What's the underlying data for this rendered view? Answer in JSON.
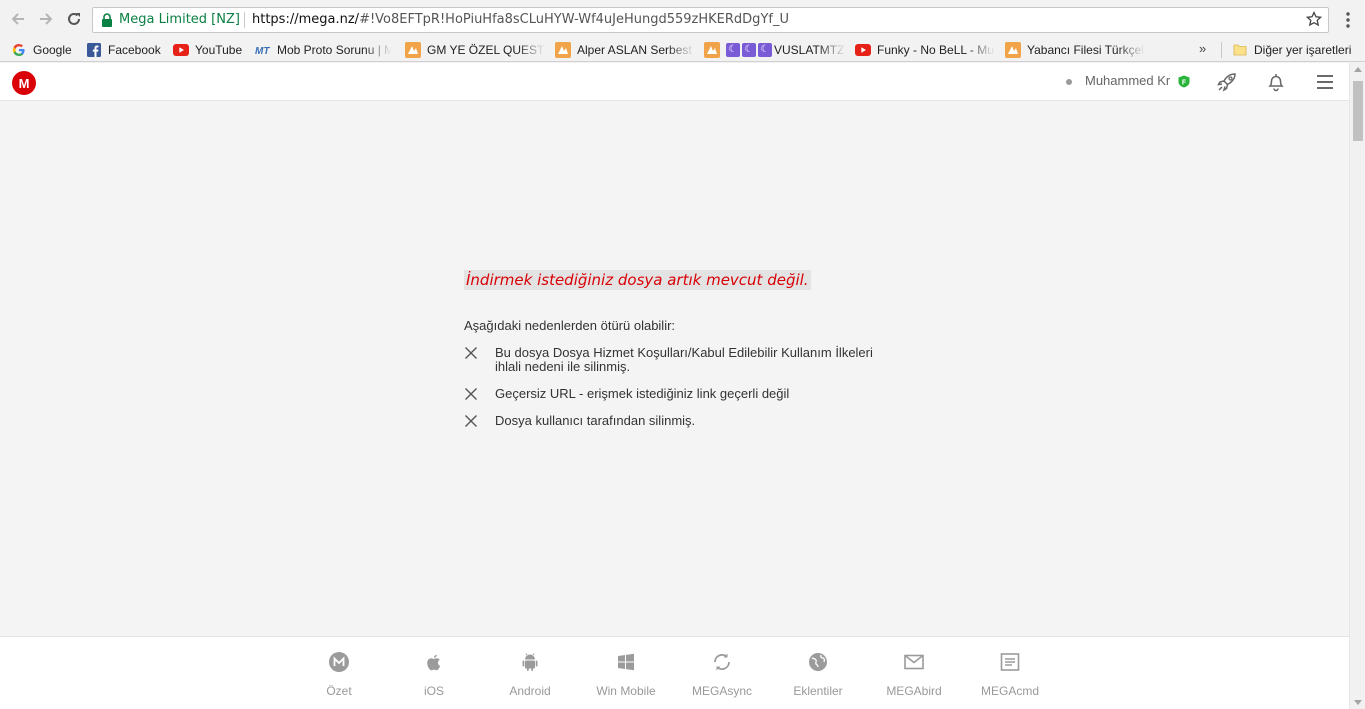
{
  "browser": {
    "secure_label": "Mega Limited [NZ]",
    "url_host": "https://mega.nz/",
    "url_path": "#!Vo8EFTpR!HoPiuHfa8sCLuHYW-Wf4uJeHungd559zHKERdDgYf_U",
    "bookmarks": [
      {
        "label": "Google",
        "icon": "google-icon"
      },
      {
        "label": "Facebook",
        "icon": "facebook-icon"
      },
      {
        "label": "YouTube",
        "icon": "youtube-icon"
      },
      {
        "label": "Mob Proto Sorunu | M",
        "icon": "mt-icon"
      },
      {
        "label": "GM YE ÖZEL QUEST |",
        "icon": "site-icon"
      },
      {
        "label": "Alper ASLAN Serbest",
        "icon": "site-icon"
      },
      {
        "label": "VUSLATMTZ",
        "icon": "site-icon"
      },
      {
        "label": "Funky - No BeLL - Mu",
        "icon": "youtube-icon"
      },
      {
        "label": "Yabancı Filesi Türkçele",
        "icon": "site-icon"
      }
    ],
    "more_bookmarks": "»",
    "other_bookmarks": "Diğer yer işaretleri"
  },
  "header": {
    "logo": "M",
    "username": "Muhammed Kr",
    "badge": "F"
  },
  "error": {
    "title": "İndirmek istediğiniz dosya artık mevcut değil.",
    "intro": "Aşağıdaki nedenlerden ötürü olabilir:",
    "reasons": [
      "Bu dosya Dosya Hizmet Koşulları/Kabul Edilebilir Kullanım İlkeleri ihlali nedeni ile silinmiş.",
      "Geçersiz URL - erişmek istediğiniz link geçerli değil",
      "Dosya kullanıcı tarafından silinmiş."
    ]
  },
  "footer": {
    "items": [
      {
        "label": "Özet",
        "icon": "mega-icon"
      },
      {
        "label": "iOS",
        "icon": "apple-icon"
      },
      {
        "label": "Android",
        "icon": "android-icon"
      },
      {
        "label": "Win Mobile",
        "icon": "windows-icon"
      },
      {
        "label": "MEGAsync",
        "icon": "sync-icon"
      },
      {
        "label": "Eklentiler",
        "icon": "globe-icon"
      },
      {
        "label": "MEGAbird",
        "icon": "mail-icon"
      },
      {
        "label": "MEGAcmd",
        "icon": "terminal-icon"
      }
    ]
  },
  "colors": {
    "accent": "#d90007",
    "secure": "#0b8043",
    "free_badge": "#28b33a"
  }
}
